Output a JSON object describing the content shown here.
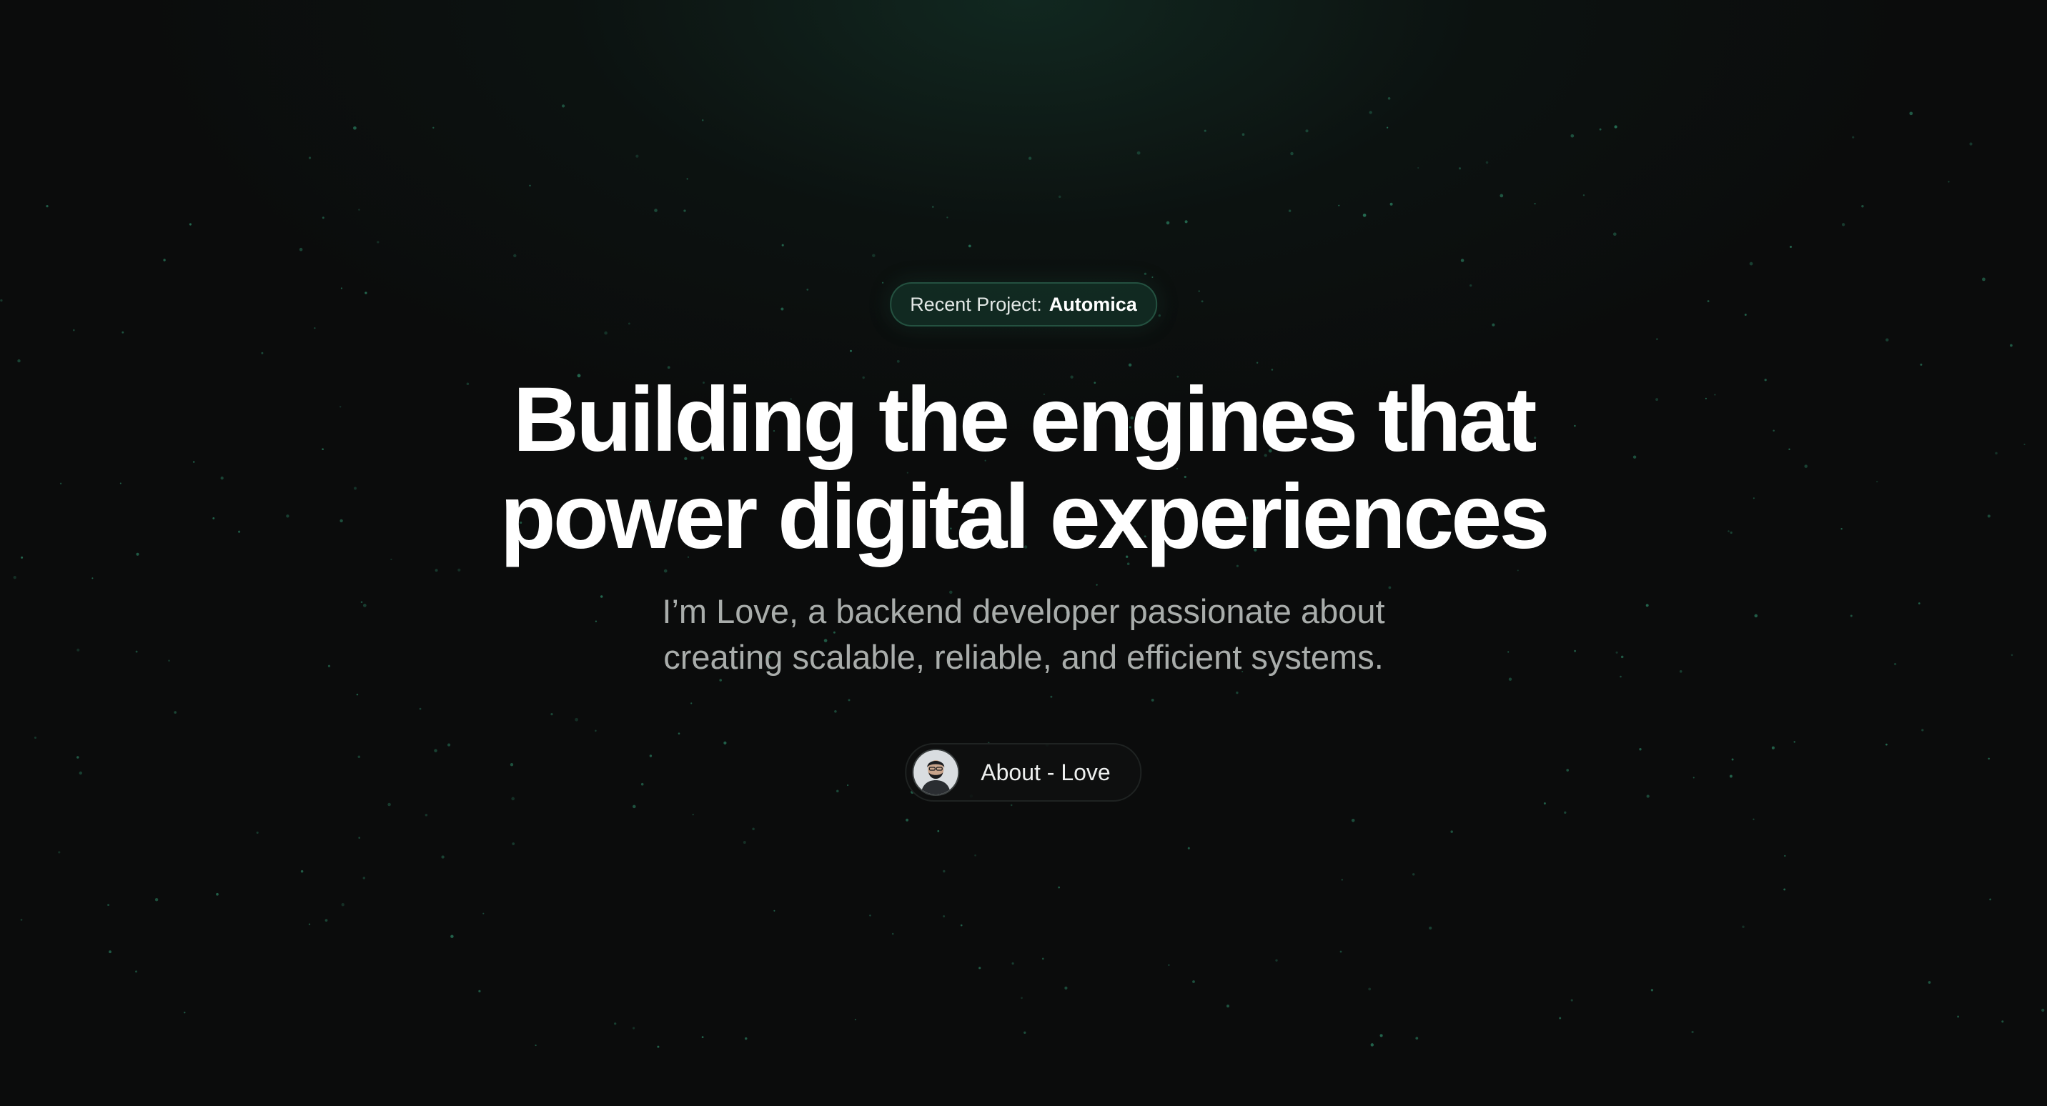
{
  "badge": {
    "label": "Recent Project:",
    "value": "Automica"
  },
  "hero": {
    "headline_lines": [
      "Building the engines that",
      "power digital experiences"
    ],
    "subtitle_lines": [
      "I’m Love, a backend developer passionate about",
      "creating scalable, reliable, and efficient systems."
    ]
  },
  "about_button": {
    "label": "About - Love"
  },
  "colors": {
    "accent_green": "#2f8f6c",
    "background": "#0b0c0c",
    "headline": "#ffffff",
    "subtitle": "#a9adab"
  }
}
